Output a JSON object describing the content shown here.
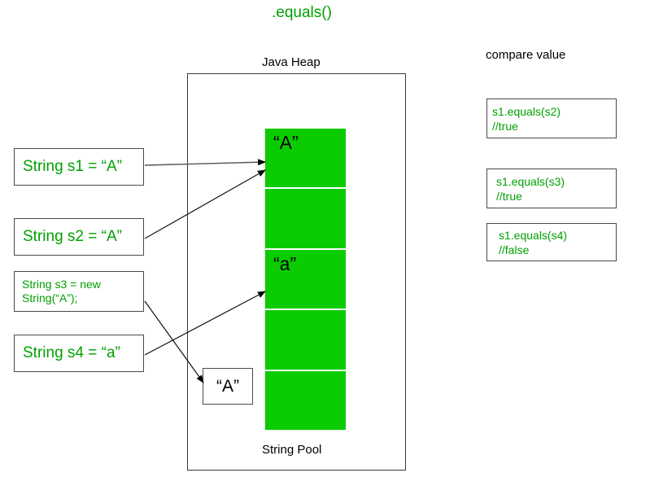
{
  "title": ".equals()",
  "heap": {
    "label": "Java Heap",
    "pool_label": "String Pool",
    "pool_cells": [
      {
        "text": "“A”"
      },
      {
        "text": ""
      },
      {
        "text": "“a”"
      },
      {
        "text": ""
      },
      {
        "text": ""
      }
    ],
    "object_box": {
      "text": "“A”"
    },
    "cell_color": "#0ACC00"
  },
  "variables": [
    {
      "name": "s1",
      "code": "String s1 = “A”"
    },
    {
      "name": "s2",
      "code": "String s2 = “A”"
    },
    {
      "name": "s3",
      "line1": "String s3 = new",
      "line2": "String(“A”);"
    },
    {
      "name": "s4",
      "code": "String s4 = “a”"
    }
  ],
  "results": {
    "heading": "compare value",
    "items": [
      {
        "expr": "s1.equals(s2)",
        "comment": "//true"
      },
      {
        "expr": "s1.equals(s3)",
        "comment": "//true"
      },
      {
        "expr": "s1.equals(s4)",
        "comment": "//false"
      }
    ]
  },
  "colors": {
    "code_green": "#00a000",
    "pool_green": "#0ACC00",
    "border": "#4a4a4a"
  }
}
